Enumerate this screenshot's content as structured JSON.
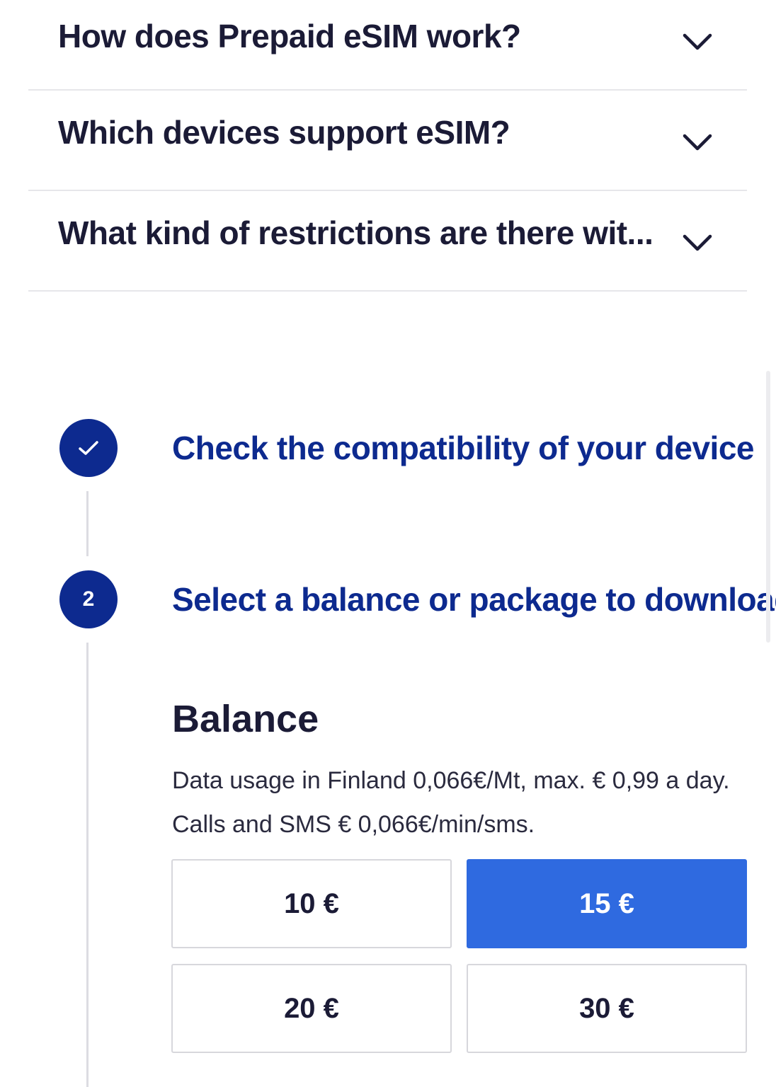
{
  "faq": {
    "items": [
      {
        "question": "How does Prepaid eSIM work?"
      },
      {
        "question": "Which devices support eSIM?"
      },
      {
        "question": "What kind of restrictions are there wit..."
      }
    ]
  },
  "steps": [
    {
      "marker": "",
      "title": "Check the compatibility of your device",
      "state": "completed"
    },
    {
      "marker": "2",
      "title": "Select a balance or package to download",
      "state": "active"
    }
  ],
  "balance": {
    "title": "Balance",
    "description": "Data usage in Finland 0,066€/Mt, max. € 0,99 a day. Calls and SMS € 0,066€/min/sms.",
    "options": [
      {
        "label": "10 €",
        "selected": false
      },
      {
        "label": "15 €",
        "selected": true
      },
      {
        "label": "20 €",
        "selected": false
      },
      {
        "label": "30 €",
        "selected": false
      }
    ]
  },
  "colors": {
    "accent": "#2f6ae0",
    "brand_navy": "#0d2a8f",
    "text": "#1b1b36"
  },
  "icons": {
    "faq_toggle": "chevron-down-icon",
    "completed_step": "checkmark-icon"
  }
}
